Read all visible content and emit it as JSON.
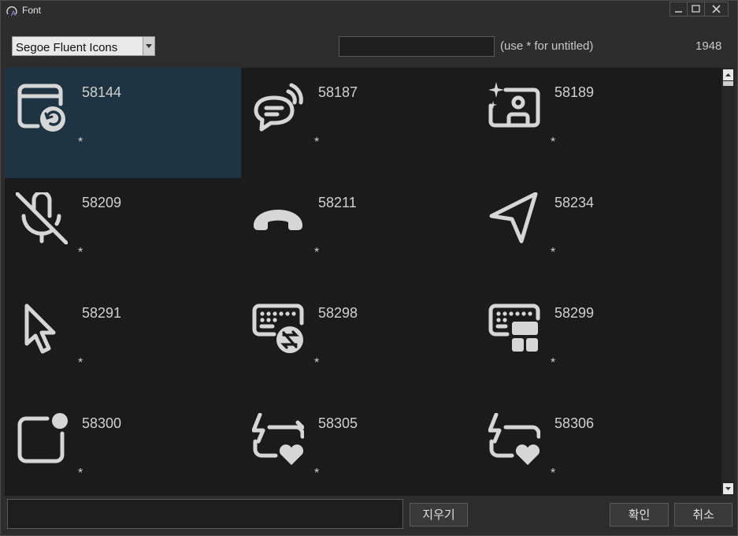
{
  "window": {
    "title": "Font"
  },
  "toolbar": {
    "font_name": "Segoe Fluent Icons",
    "search_value": "",
    "hint": "(use * for untitled)",
    "count": "1948"
  },
  "glyphs": [
    {
      "code": "58144",
      "name": "*",
      "icon": "calendar-refresh-icon",
      "selected": true
    },
    {
      "code": "58187",
      "name": "*",
      "icon": "chat-broadcast-icon"
    },
    {
      "code": "58189",
      "name": "*",
      "icon": "contact-sparkle-icon"
    },
    {
      "code": "58209",
      "name": "*",
      "icon": "mic-off-icon"
    },
    {
      "code": "58211",
      "name": "*",
      "icon": "phone-hangup-icon"
    },
    {
      "code": "58234",
      "name": "*",
      "icon": "send-arrow-icon"
    },
    {
      "code": "58291",
      "name": "*",
      "icon": "cursor-pointer-icon"
    },
    {
      "code": "58298",
      "name": "*",
      "icon": "keyboard-sync-icon"
    },
    {
      "code": "58299",
      "name": "*",
      "icon": "keyboard-layout-icon"
    },
    {
      "code": "58300",
      "name": "*",
      "icon": "app-badge-icon"
    },
    {
      "code": "58305",
      "name": "*",
      "icon": "flash-repeat-heart-icon"
    },
    {
      "code": "58306",
      "name": "*",
      "icon": "flash-repeat-heart-icon"
    }
  ],
  "footer": {
    "input_value": "",
    "clear_label": "지우기",
    "ok_label": "확인",
    "cancel_label": "취소"
  },
  "colors": {
    "selected_cell": "#1f3442",
    "grid_bg": "#1b1b1b",
    "glyph": "#d6d6d6"
  }
}
